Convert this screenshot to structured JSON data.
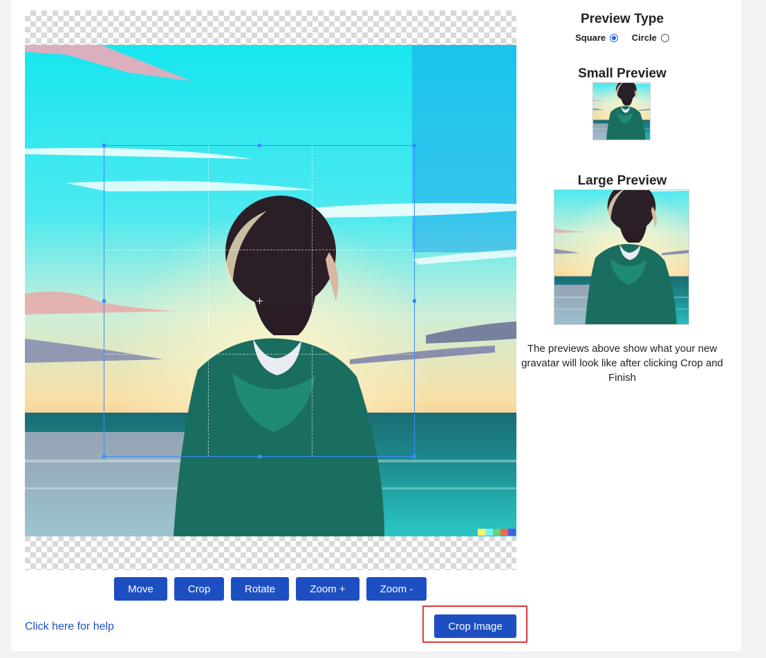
{
  "toolbar": {
    "move_label": "Move",
    "crop_label": "Crop",
    "rotate_label": "Rotate",
    "zoom_in_label": "Zoom +",
    "zoom_out_label": "Zoom -"
  },
  "help_link": "Click here for help",
  "crop_image_label": "Crop Image",
  "preview_type": {
    "title": "Preview Type",
    "options": [
      {
        "label": "Square",
        "selected": true
      },
      {
        "label": "Circle",
        "selected": false
      }
    ]
  },
  "small_preview": {
    "title": "Small Preview"
  },
  "large_preview": {
    "title": "Large Preview"
  },
  "description": "The previews above show what your new gravatar will look like after clicking Crop and Finish",
  "colors": {
    "button": "#1e4fc2",
    "crop_box": "#3a8bff",
    "highlight": "#e0383b"
  },
  "icons": [
    "crop-center-crosshair-icon"
  ]
}
